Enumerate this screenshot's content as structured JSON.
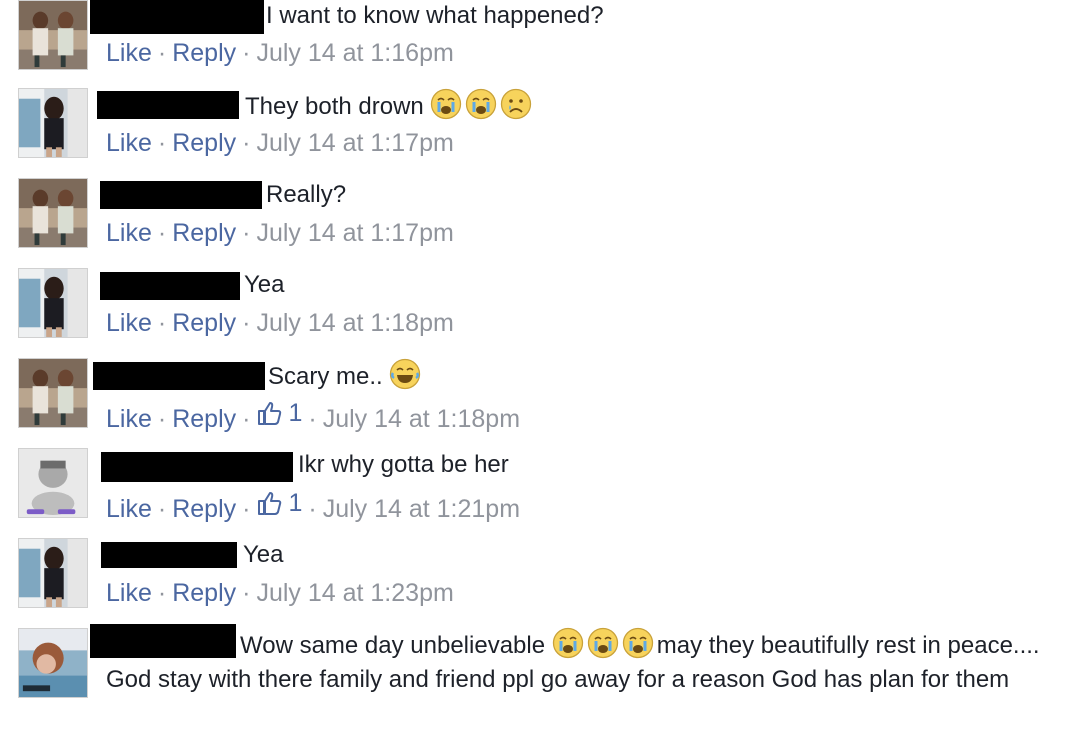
{
  "comments": [
    {
      "text": "I want to know what happened?",
      "actions": {
        "like": "Like",
        "reply": "Reply"
      },
      "timestamp": "July 14 at 1:16pm",
      "avatar_icon": "girls-photo-avatar-icon"
    },
    {
      "text": "They both drown",
      "emojis": [
        "crying-face-icon",
        "crying-face-icon",
        "sad-face-icon"
      ],
      "actions": {
        "like": "Like",
        "reply": "Reply"
      },
      "timestamp": "July 14 at 1:17pm",
      "avatar_icon": "girl-photo-avatar-icon"
    },
    {
      "text": "Really?",
      "actions": {
        "like": "Like",
        "reply": "Reply"
      },
      "timestamp": "July 14 at 1:17pm",
      "avatar_icon": "girls-photo-avatar-icon"
    },
    {
      "text": "Yea",
      "actions": {
        "like": "Like",
        "reply": "Reply"
      },
      "timestamp": "July 14 at 1:18pm",
      "avatar_icon": "girl-photo-avatar-icon"
    },
    {
      "text": "Scary me..",
      "emojis": [
        "laughing-face-icon"
      ],
      "actions": {
        "like": "Like",
        "reply": "Reply"
      },
      "like_count": "1",
      "timestamp": "July 14 at 1:18pm",
      "avatar_icon": "girls-photo-avatar-icon"
    },
    {
      "text": "Ikr why gotta be her",
      "actions": {
        "like": "Like",
        "reply": "Reply"
      },
      "like_count": "1",
      "timestamp": "July 14 at 1:21pm",
      "avatar_icon": "grayscale-photo-avatar-icon"
    },
    {
      "text": "Yea",
      "actions": {
        "like": "Like",
        "reply": "Reply"
      },
      "timestamp": "July 14 at 1:23pm",
      "avatar_icon": "girl-photo-avatar-icon"
    },
    {
      "text_before": "Wow same day unbelievable",
      "emojis": [
        "crying-face-icon",
        "crying-face-icon",
        "crying-face-icon"
      ],
      "text_after": "may they beautifully rest in peace.... God stay with there family and friend ppl go away for a reason God has plan for them",
      "avatar_icon": "selfie-photo-avatar-icon"
    }
  ],
  "colors": {
    "link": "#4b67a1",
    "meta": "#90949c",
    "text": "#1d2129",
    "redaction": "#000000"
  }
}
